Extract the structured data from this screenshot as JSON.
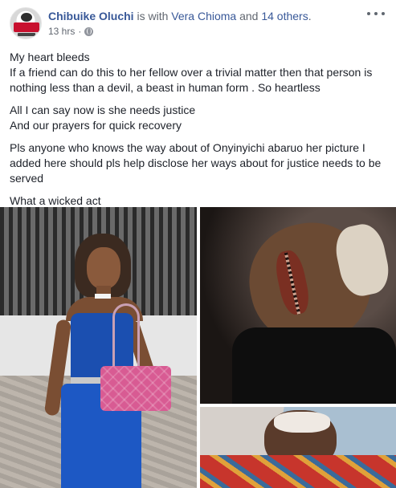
{
  "post": {
    "author": "Chibuike Oluchi",
    "with_text": " is with ",
    "tagged_person": "Vera Chioma",
    "and_text": " and ",
    "others_link": "14 others",
    "others_suffix": ".",
    "timestamp": "13 hrs",
    "separator": "·",
    "privacy_icon": "globe-icon",
    "more_icon": "more-options-icon",
    "paragraphs": [
      "My heart bleeds",
      "If a friend can do this to her fellow over a trivial matter then that person is nothing less than a devil, a beast in human form . So heartless",
      "All I can say now is she needs justice",
      "And our prayers for quick recovery",
      "Pls anyone who knows the way about of Onyinyichi abaruo her picture I added here should pls help disclose her ways about for justice needs to be served",
      "What a wicked act"
    ]
  },
  "colors": {
    "link": "#385898",
    "text": "#1d2129",
    "meta": "#616770"
  }
}
